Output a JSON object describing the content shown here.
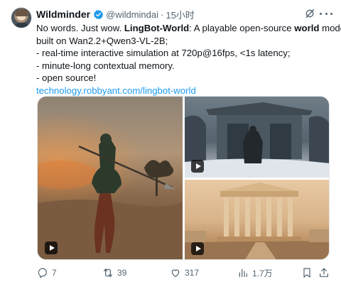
{
  "tweet": {
    "author_name": "Wildminder",
    "handle": "@wildmindai",
    "dot": "·",
    "time": "15小时",
    "text": {
      "line1_a": "No words. Just wow. ",
      "line1_b": "LingBot-World",
      "line1_c": ": A playable open-source ",
      "line1_d": "world",
      "line1_e": " model",
      "line2": "built on Wan2.2+Qwen3-VL-2B;",
      "line3": "- real-time interactive simulation at 720p@16fps, <1s latency;",
      "line4": "- minute-long contextual memory.",
      "line5": "- open source!",
      "link": "technology.robbyant.com/lingbot-world"
    },
    "stats": {
      "replies": "7",
      "retweets": "39",
      "likes": "317",
      "views": "1.7万"
    }
  },
  "colors": {
    "link": "#1d9bf0",
    "verified": "#1d9bf0",
    "muted": "#536471"
  },
  "icons": {
    "verified": "verified-badge-icon",
    "grok": "grok-icon",
    "more": "more-icon",
    "reply": "reply-icon",
    "retweet": "retweet-icon",
    "like": "heart-icon",
    "views": "views-icon",
    "bookmark": "bookmark-icon",
    "share": "share-icon",
    "play": "play-icon"
  },
  "media": [
    {
      "kind": "video",
      "subject": "armored warrior on horse in battlefield"
    },
    {
      "kind": "video",
      "subject": "knight before temple in snow"
    },
    {
      "kind": "video",
      "subject": "parthenon ruins"
    }
  ]
}
